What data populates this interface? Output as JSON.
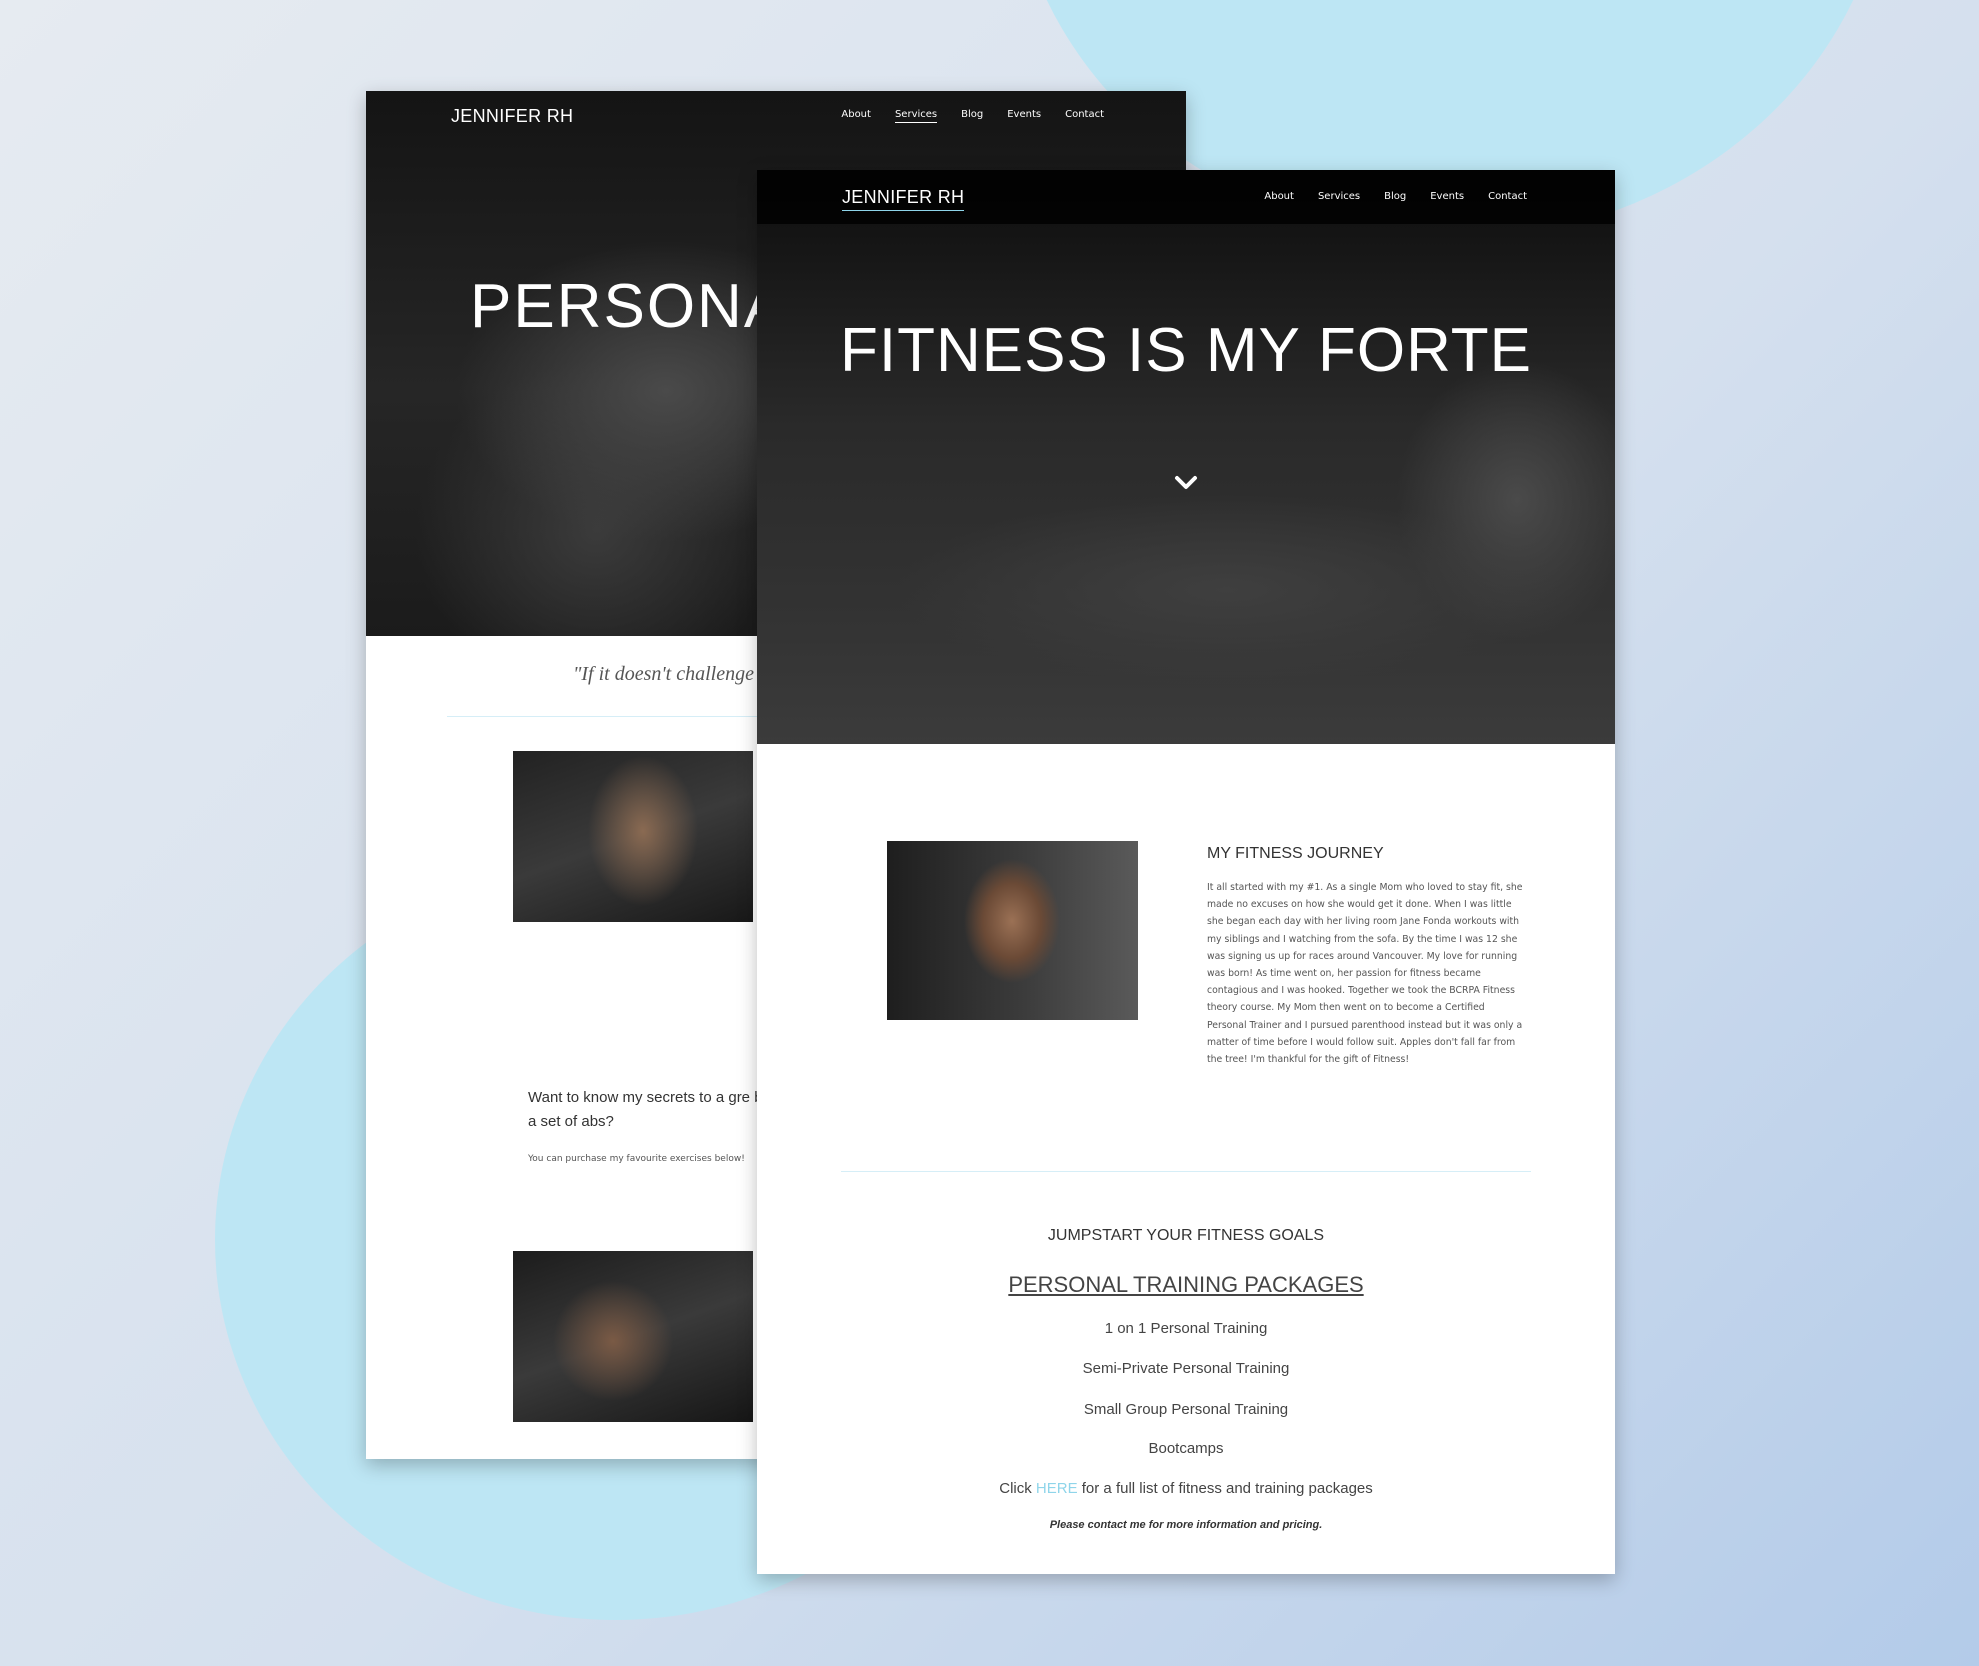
{
  "back_page": {
    "nav": {
      "logo": "JENNIFER RH",
      "links": [
        "About",
        "Services",
        "Blog",
        "Events",
        "Contact"
      ],
      "active": "Services"
    },
    "hero_title": "PERSONA",
    "quote": "\"If it doesn't challenge",
    "secret_heading": "Want to know my secrets to a gre booty and a set of abs?",
    "secret_sub": "You can purchase my favourite exercises below!"
  },
  "front_page": {
    "nav": {
      "logo": "JENNIFER RH",
      "links": [
        "About",
        "Services",
        "Blog",
        "Events",
        "Contact"
      ]
    },
    "hero_title": "FITNESS IS MY FORTE",
    "journey": {
      "title": "MY FITNESS JOURNEY",
      "body": "It all started with my #1. As a single Mom who loved to stay fit, she made no excuses on how she would get it done. When I was little she began each day with her living room Jane Fonda workouts with my siblings and I watching from the sofa. By the time I was 12 she was signing us up for races around Vancouver.  My love for running was born! As time went on, her passion for fitness became contagious and I was hooked. Together we took the BCRPA Fitness theory course. My Mom then went on to become a Certified Personal Trainer and I pursued parenthood instead but it was only a matter of time before I would follow suit. Apples don't fall far from the tree! I'm thankful for the gift of Fitness!"
    },
    "jumpstart": "JUMPSTART YOUR FITNESS GOALS",
    "packages_title": "PERSONAL TRAINING PACKAGES",
    "packages": [
      "1 on 1  Personal Training",
      "Semi-Private Personal Training",
      "Small Group Personal Training",
      "Bootcamps"
    ],
    "click_prefix": "Click ",
    "click_link": "HERE",
    "click_suffix": " for a full list of fitness and training packages",
    "note": "Please contact me for more information and pricing."
  },
  "colors": {
    "accent": "#8fd5ea",
    "blob": "#bde6f4",
    "nav_bg": "#000000"
  },
  "icons": [
    "chevron-down-icon"
  ]
}
